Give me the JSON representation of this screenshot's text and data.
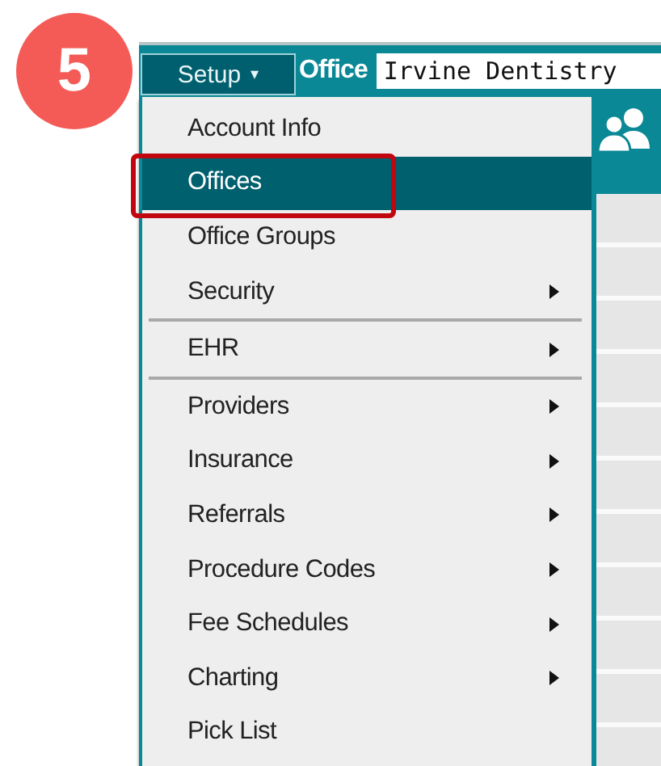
{
  "step_badge": "5",
  "toolbar": {
    "menu_button": "Setup",
    "caret": "▾",
    "field_label": "Office",
    "office_field": {
      "value": "Irvine Dentistry"
    }
  },
  "menu_groups": [
    [
      {
        "label": "Account Info",
        "selected": false,
        "submenu": false,
        "callout": false
      },
      {
        "label": "Offices",
        "selected": true,
        "submenu": false,
        "callout": true
      },
      {
        "label": "Office Groups",
        "selected": false,
        "submenu": false,
        "callout": false
      },
      {
        "label": "Security",
        "selected": false,
        "submenu": true,
        "callout": false
      }
    ],
    [
      {
        "label": "EHR",
        "selected": false,
        "submenu": true,
        "callout": false
      }
    ],
    [
      {
        "label": "Providers",
        "selected": false,
        "submenu": true,
        "callout": false
      },
      {
        "label": "Insurance",
        "selected": false,
        "submenu": true,
        "callout": false
      },
      {
        "label": "Referrals",
        "selected": false,
        "submenu": true,
        "callout": false
      },
      {
        "label": "Procedure Codes",
        "selected": false,
        "submenu": true,
        "callout": false
      },
      {
        "label": "Fee Schedules",
        "selected": false,
        "submenu": true,
        "callout": false
      },
      {
        "label": "Charting",
        "selected": false,
        "submenu": true,
        "callout": false
      },
      {
        "label": "Pick List",
        "selected": false,
        "submenu": false,
        "callout": false
      }
    ]
  ]
}
